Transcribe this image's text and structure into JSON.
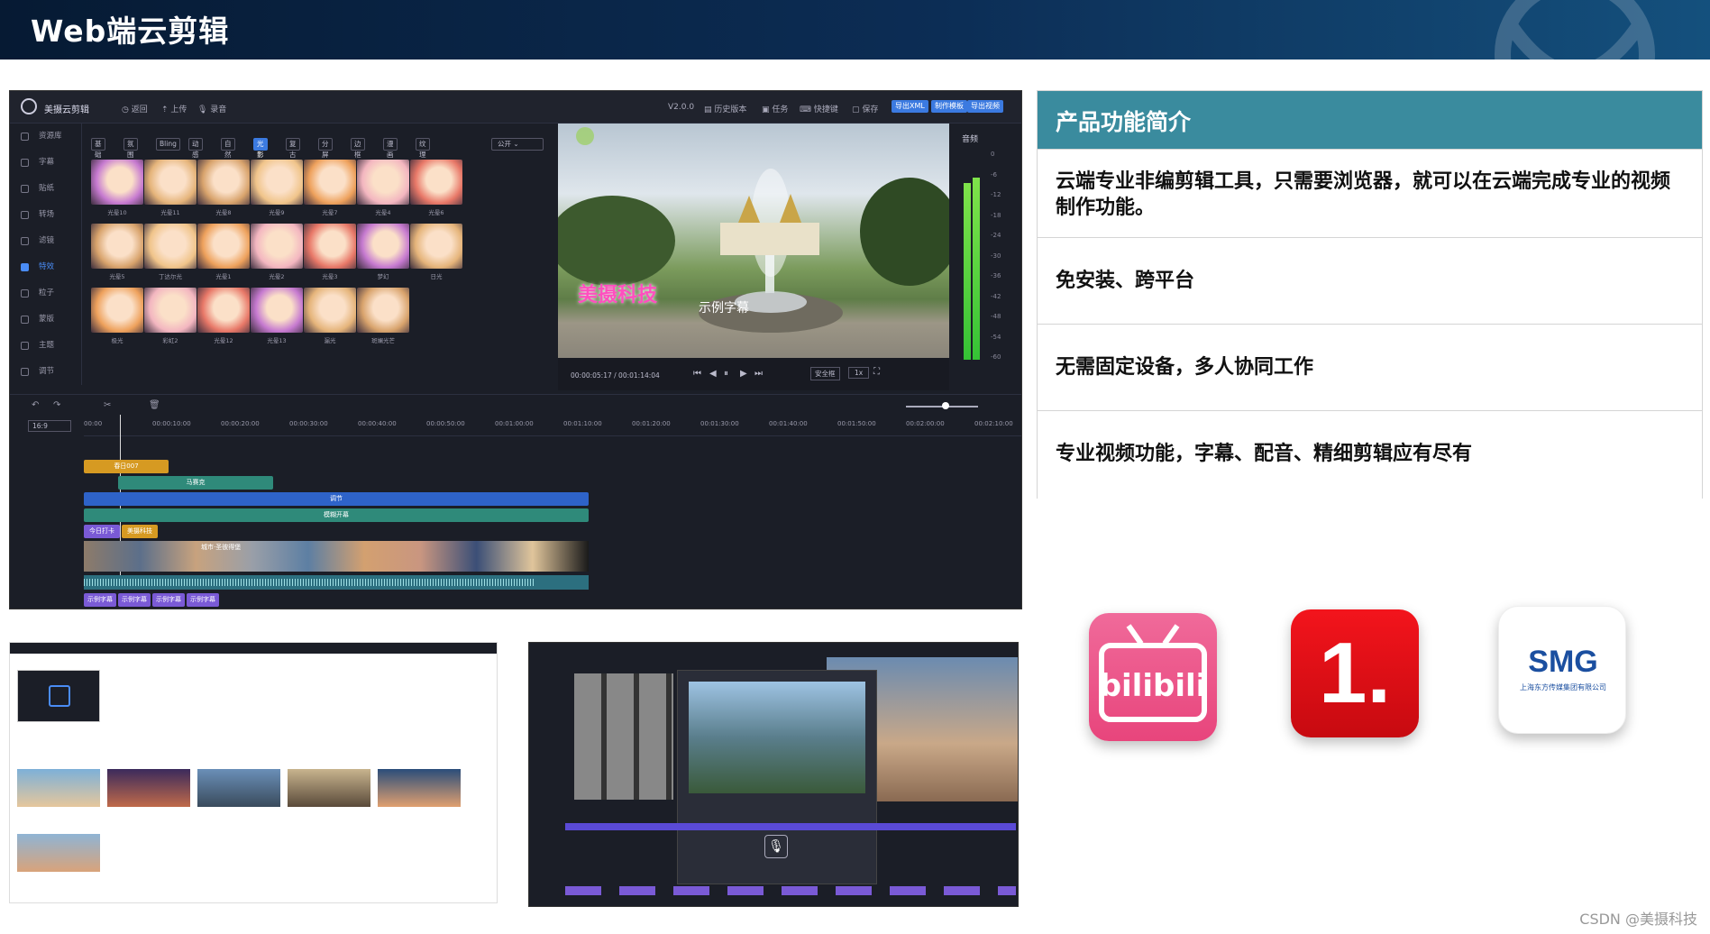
{
  "header": {
    "title": "Web端云剪辑"
  },
  "editor": {
    "brand": "美摄云剪辑",
    "nav": [
      "返回",
      "上传",
      "录音"
    ],
    "version": "V2.0.0",
    "top_links": [
      "历史版本",
      "任务",
      "快捷键",
      "保存"
    ],
    "top_buttons": [
      "导出XML",
      "制作模板",
      "导出视频"
    ],
    "sidebar": [
      "资源库",
      "字幕",
      "贴纸",
      "转场",
      "滤镜",
      "特效",
      "粒子",
      "蒙版",
      "主题",
      "调节"
    ],
    "filter_tabs": [
      "基础",
      "氛围",
      "Bling",
      "动感",
      "自然",
      "光影",
      "复古",
      "分屏",
      "边框",
      "漫画",
      "纹理"
    ],
    "filter_select": "公开",
    "effects": [
      [
        "光晕10",
        "光晕11",
        "光晕8",
        "光晕9",
        "光晕7",
        "光晕4",
        "光晕6"
      ],
      [
        "光晕5",
        "丁达尔光",
        "光晕1",
        "光晕2",
        "光晕3",
        "梦幻",
        "日光"
      ],
      [
        "极光",
        "彩虹2",
        "光晕12",
        "光晕13",
        "漏光",
        "斑斓光芒"
      ]
    ],
    "preview": {
      "caption_brand": "美摄科技",
      "caption_sample": "示例字幕",
      "time": "00:00:05:17 / 00:01:14:04",
      "safe_frame": "安全框",
      "speed": "1x"
    },
    "audio_label": "音频",
    "meter_ticks": [
      "0",
      "-6",
      "-12",
      "-18",
      "-24",
      "-30",
      "-36",
      "-42",
      "-48",
      "-54",
      "-60"
    ],
    "ratio": "16:9",
    "ruler": [
      "00:00",
      "00:00:10:00",
      "00:00:20:00",
      "00:00:30:00",
      "00:00:40:00",
      "00:00:50:00",
      "00:01:00:00",
      "00:01:10:00",
      "00:01:20:00",
      "00:01:30:00",
      "00:01:40:00",
      "00:01:50:00",
      "00:02:00:00",
      "00:02:10:00"
    ],
    "tracks": {
      "t1": "春日007",
      "t2": "马赛克",
      "t3": "调节",
      "t4": "模糊开幕",
      "t5a": "今日打卡",
      "t5b": "美摄科技",
      "v_titles": [
        "城市·圣彼得堡"
      ],
      "subs": [
        "示例字幕",
        "示例字幕",
        "示例字幕",
        "示例字幕"
      ]
    }
  },
  "panel": {
    "title": "产品功能简介",
    "items": [
      "云端专业非编剪辑工具，只需要浏览器，就可以在云端完成专业的视频制作功能。",
      "免安装、跨平台",
      "无需固定设备，多人协同工作",
      "专业视频功能，字幕、配音、精细剪辑应有尽有"
    ]
  },
  "logos": {
    "smg": "SMG",
    "smg_sub": "上海东方传媒集团有限公司",
    "one": "1."
  },
  "footer": {
    "credit": "CSDN @美摄科技"
  }
}
